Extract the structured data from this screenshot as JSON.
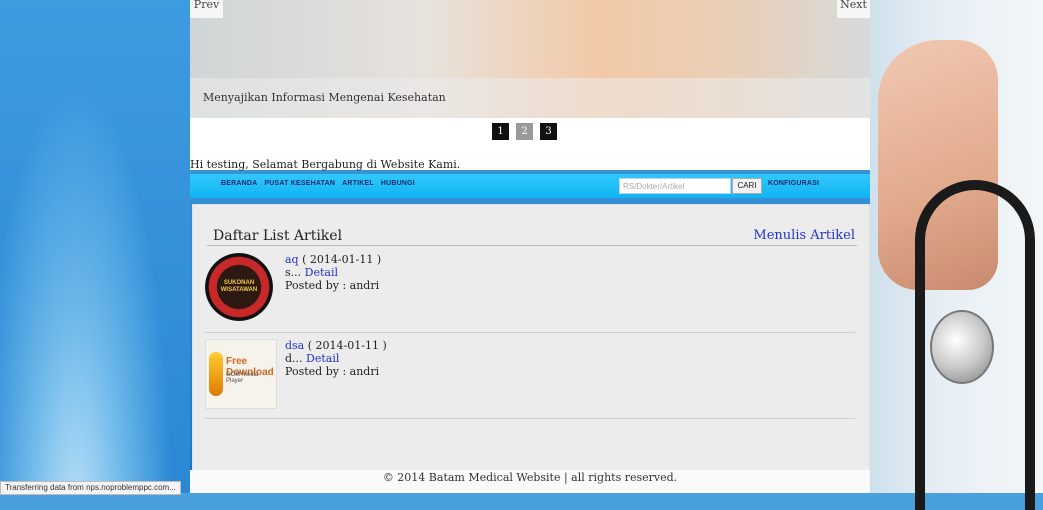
{
  "slider": {
    "prev_label": "Prev",
    "next_label": "Next",
    "caption": "Menyajikan Informasi Mengenai Kesehatan",
    "pages": [
      "1",
      "2",
      "3"
    ],
    "active_page": 1
  },
  "greeting": "Hi testing, Selamat Bergabung di Website Kami.",
  "nav": {
    "items": [
      "BERANDA",
      "PUSAT KESEHATAN",
      "ARTIKEL",
      "HUBUNGI"
    ],
    "search_placeholder": "RS/Dokter/Artikel",
    "search_button": "CARI",
    "config_label": "KONFIGURASI"
  },
  "articles_section": {
    "title": "Daftar List Artikel",
    "write_link": "Menulis Artikel",
    "articles": [
      {
        "title": "aq",
        "date": "( 2014-01-11 )",
        "excerpt": "s...",
        "detail_link": "Detail",
        "posted_by": "Posted by : andri",
        "thumb_text": "SUKONAN WISATAWAN",
        "thumb_icon": "badge-seal-icon"
      },
      {
        "title": "dsa",
        "date": "( 2014-01-11 )",
        "excerpt": "d...",
        "detail_link": "Detail",
        "posted_by": "Posted by : andri",
        "thumb_text": "Free Download",
        "thumb_subtext": "GOM Media Player",
        "thumb_icon": "download-icon"
      }
    ]
  },
  "footer": "© 2014 Batam Medical Website | all rights reserved.",
  "status_bar": "Transferring data from nps.noproblemppc.com...",
  "colors": {
    "nav_bar": "#1ab9f5",
    "link": "#2233cc",
    "content_bg": "#ececec"
  }
}
